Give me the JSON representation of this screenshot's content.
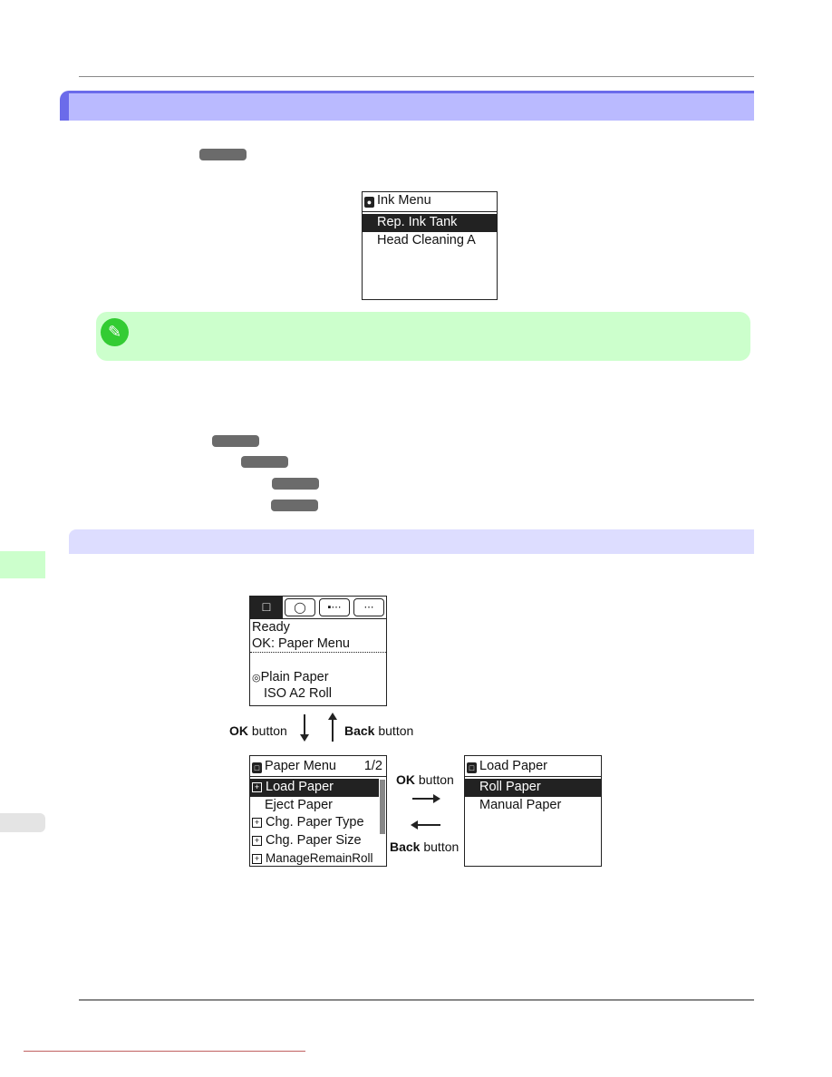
{
  "colors": {
    "section_header": "#babaff",
    "section_border": "#6b6bea",
    "subsection_header": "#ddddff",
    "note_bg": "#ccffcc",
    "note_icon": "#33cc33",
    "side_tab": "#ccffcc",
    "key_pill": "#6b6b6b"
  },
  "ink_menu": {
    "title": "Ink Menu",
    "items": [
      "Rep. Ink Tank",
      "Head Cleaning A"
    ],
    "selected": 0
  },
  "note": {
    "icon": "pencil-icon"
  },
  "diagram": {
    "ready_screen": {
      "tabs": [
        "paper-icon",
        "ink-drop-icon",
        "job-icon",
        "settings-icon"
      ],
      "line1": "Ready",
      "line2": "OK: Paper Menu",
      "media": "Plain Paper",
      "size": "ISO A2 Roll"
    },
    "ok_label_bold": "OK",
    "button_word": "button",
    "back_label_bold": "Back",
    "paper_menu": {
      "title": "Paper Menu",
      "page": "1/2",
      "items": [
        {
          "label": "Load Paper",
          "sub": true
        },
        {
          "label": "Eject Paper",
          "sub": false
        },
        {
          "label": "Chg. Paper Type",
          "sub": true
        },
        {
          "label": "Chg. Paper Size",
          "sub": true
        },
        {
          "label": "ManageRemainRoll",
          "sub": true
        }
      ],
      "selected": 0
    },
    "load_paper": {
      "title": "Load Paper",
      "items": [
        "Roll Paper",
        "Manual Paper"
      ],
      "selected": 0
    }
  }
}
